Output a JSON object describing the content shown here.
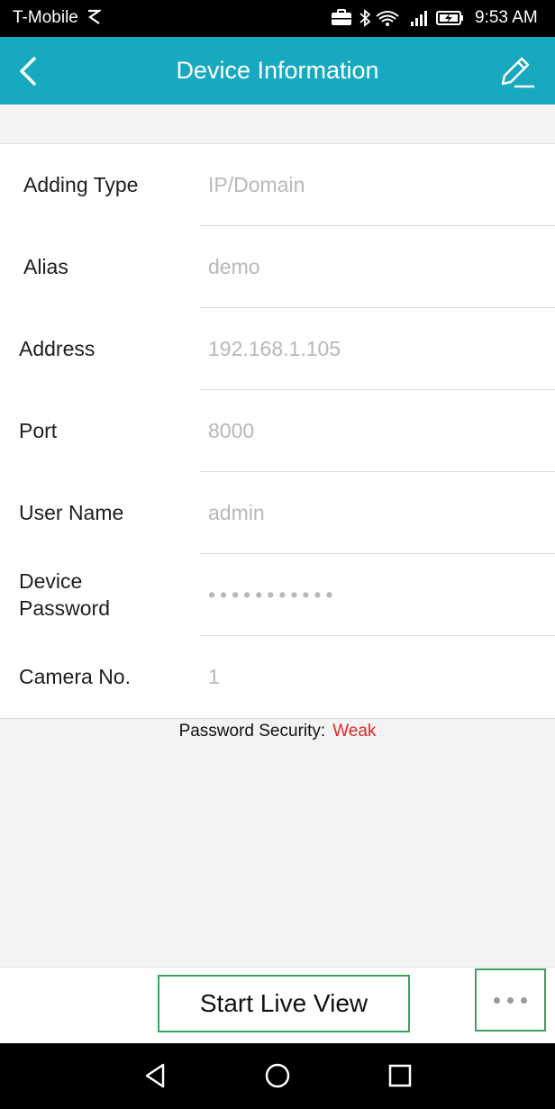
{
  "status_bar": {
    "carrier": "T-Mobile",
    "time": "9:53 AM",
    "icons": [
      "briefcase-icon",
      "bluetooth-icon",
      "wifi-icon",
      "signal-icon",
      "battery-charging-icon"
    ]
  },
  "header": {
    "title": "Device Information",
    "back_icon": "chevron-left-icon",
    "edit_icon": "pencil-edit-icon",
    "background_color": "#16a9bf"
  },
  "form": {
    "rows": [
      {
        "label": "Adding Type",
        "value": "IP/Domain"
      },
      {
        "label": "Alias",
        "value": "demo"
      },
      {
        "label": "Address",
        "value": "192.168.1.105"
      },
      {
        "label": "Port",
        "value": "8000"
      },
      {
        "label": "User Name",
        "value": "admin"
      },
      {
        "label": "Device Password",
        "value": "•••••••••••"
      },
      {
        "label": "Camera No.",
        "value": "1"
      }
    ]
  },
  "password_security": {
    "label": "Password Security:",
    "level": "Weak",
    "level_color": "#e02828"
  },
  "actions": {
    "start_live_view": "Start Live View",
    "more_icon": "more-horizontal-icon"
  },
  "nav_bar": {
    "icons": [
      "back-triangle-icon",
      "home-circle-icon",
      "recents-square-icon"
    ]
  }
}
